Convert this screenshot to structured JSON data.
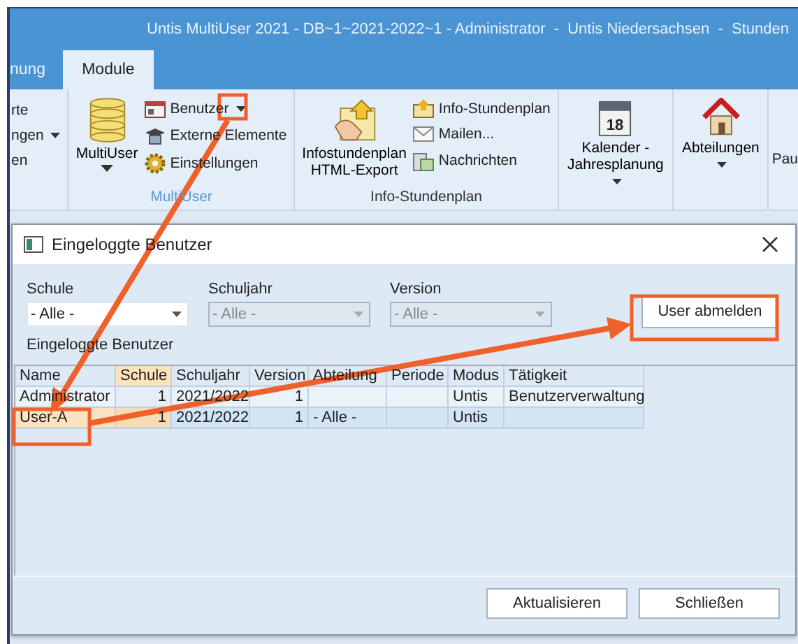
{
  "window": {
    "title": "Untis MultiUser 2021 - DB~1~2021-2022~1 - Administrator  -  Untis Niedersachsen  -  Stunden"
  },
  "tabs": [
    {
      "label": "nung",
      "selected": false
    },
    {
      "label": "Module",
      "selected": true
    }
  ],
  "ribbon": {
    "partial_items": [
      {
        "label": "rte"
      },
      {
        "label": "ngen",
        "caret": true
      },
      {
        "label": "en"
      }
    ],
    "groups": [
      {
        "label": "MultiUser",
        "label_highlighted": true,
        "big": {
          "label": "MultiUser",
          "caret": true
        },
        "items": [
          {
            "label": "Benutzer",
            "caret": true
          },
          {
            "label": "Externe Elemente"
          },
          {
            "label": "Einstellungen"
          }
        ]
      },
      {
        "label": "Info-Stundenplan",
        "big": {
          "label": "Infostundenplan HTML-Export"
        },
        "items": [
          {
            "label": "Info-Stundenplan"
          },
          {
            "label": "Mailen..."
          },
          {
            "label": "Nachrichten"
          }
        ]
      },
      {
        "big": {
          "label": "Kalender - Jahresplanung",
          "caret": true,
          "icon_text": "18"
        }
      },
      {
        "big": {
          "label": "Abteilungen",
          "caret": true
        }
      }
    ],
    "cut_item": "Pau"
  },
  "dialog": {
    "title": "Eingeloggte Benutzer",
    "filters": [
      {
        "label": "Schule",
        "value": "- Alle -",
        "disabled": false
      },
      {
        "label": "Schuljahr",
        "value": "- Alle -",
        "disabled": true
      },
      {
        "label": "Version",
        "value": "- Alle -",
        "disabled": true
      }
    ],
    "logout_button": "User abmelden",
    "list_label": "Eingeloggte Benutzer",
    "table": {
      "columns": [
        {
          "label": "Name",
          "sorted": false
        },
        {
          "label": "Schule",
          "sorted": true
        },
        {
          "label": "Schuljahr",
          "sorted": false
        },
        {
          "label": "Version",
          "sorted": false
        },
        {
          "label": "Abteilung",
          "sorted": false
        },
        {
          "label": "Periode",
          "sorted": false
        },
        {
          "label": "Modus",
          "sorted": false
        },
        {
          "label": "Tätigkeit",
          "sorted": false
        }
      ],
      "rows": [
        {
          "selected": false,
          "cells": [
            "Administrator",
            "1",
            "2021/2022",
            "1",
            "",
            "",
            "Untis",
            "Benutzerverwaltung"
          ]
        },
        {
          "selected": true,
          "cells": [
            "User-A",
            "1",
            "2021/2022",
            "1",
            "- Alle -",
            "",
            "Untis",
            ""
          ]
        }
      ]
    },
    "buttons": [
      "Aktualisieren",
      "Schließen"
    ]
  }
}
